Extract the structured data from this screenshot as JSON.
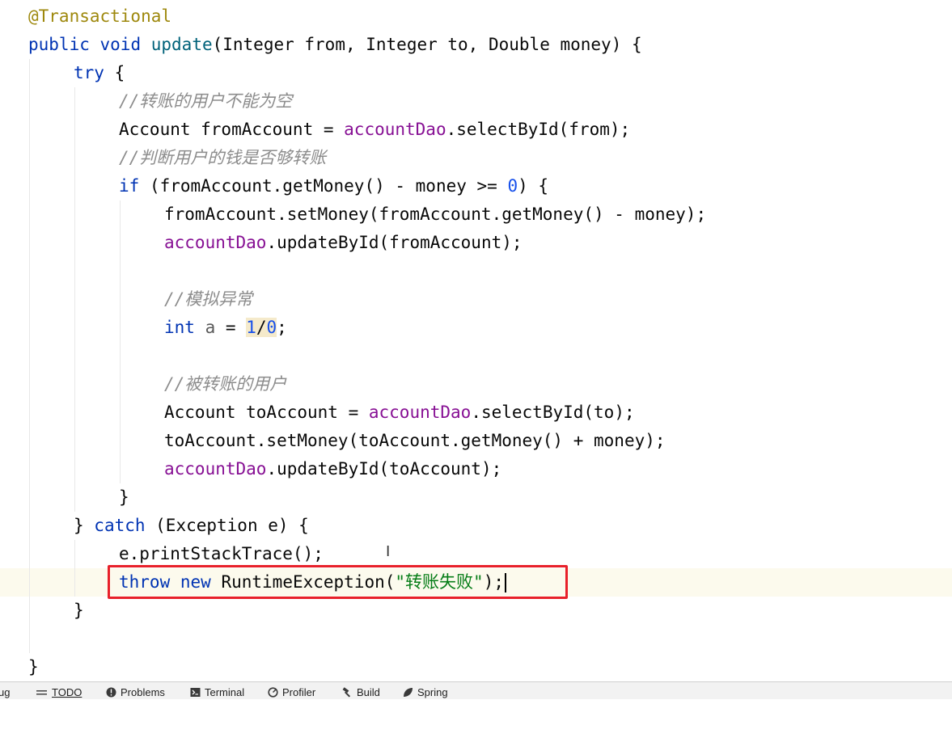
{
  "code_lines": [
    "@Transactional",
    "public void update(Integer from, Integer to, Double money) {",
    "try {",
    "//转账的用户不能为空",
    "Account fromAccount = accountDao.selectById(from);",
    "//判断用户的钱是否够转账",
    "if (fromAccount.getMoney() - money >= 0) {",
    "fromAccount.setMoney(fromAccount.getMoney() - money);",
    "accountDao.updateById(fromAccount);",
    "",
    "//模拟异常",
    "int a = 1/0;",
    "",
    "//被转账的用户",
    "Account toAccount = accountDao.selectById(to);",
    "toAccount.setMoney(toAccount.getMoney() + money);",
    "accountDao.updateById(toAccount);",
    "}",
    "} catch (Exception e) {",
    "e.printStackTrace();",
    "throw new RuntimeException(\"转账失败\");",
    "}",
    "",
    "}"
  ],
  "tokens": {
    "l0": {
      "ann": "@Transactional"
    },
    "l1": {
      "kw1": "public",
      "kw2": "void",
      "fn": "update",
      "rest": "(Integer from, Integer to, Double money) {"
    },
    "l2": {
      "kw": "try",
      "rest": " {"
    },
    "l3": {
      "cmt": "//转账的用户不能为空"
    },
    "l4": {
      "a": "Account fromAccount = ",
      "fld": "accountDao",
      "b": ".selectById(from);"
    },
    "l5": {
      "cmt": "//判断用户的钱是否够转账"
    },
    "l6": {
      "kw": "if",
      "a": " (fromAccount.getMoney() - money >= ",
      "num": "0",
      "b": ") {"
    },
    "l7": {
      "a": "fromAccount.setMoney(fromAccount.getMoney() - money);"
    },
    "l8": {
      "fld": "accountDao",
      "b": ".updateById(fromAccount);"
    },
    "l10": {
      "cmt": "//模拟异常"
    },
    "l11": {
      "kw": "int",
      "var": "a",
      "eq": " = ",
      "n1": "1",
      "slash": "/",
      "n2": "0",
      "semi": ";"
    },
    "l13": {
      "cmt": "//被转账的用户"
    },
    "l14": {
      "a": "Account toAccount = ",
      "fld": "accountDao",
      "b": ".selectById(to);"
    },
    "l15": {
      "a": "toAccount.setMoney(toAccount.getMoney() + money);"
    },
    "l16": {
      "fld": "accountDao",
      "b": ".updateById(toAccount);"
    },
    "l17": {
      "a": "}"
    },
    "l18": {
      "a": "} ",
      "kw": "catch",
      "b": " (Exception e) {"
    },
    "l19": {
      "a": "e.printStackTrace();"
    },
    "l20": {
      "kw1": "throw",
      "kw2": "new",
      "a": "RuntimeException(",
      "str": "\"转账失败\"",
      "b": ");"
    },
    "l21": {
      "a": "}"
    },
    "l23": {
      "a": "}"
    }
  },
  "toolbar": {
    "items": [
      {
        "label": "ug",
        "icon": "bug-icon"
      },
      {
        "label": "TODO",
        "icon": "list-icon"
      },
      {
        "label": "Problems",
        "icon": "error-icon"
      },
      {
        "label": "Terminal",
        "icon": "terminal-icon"
      },
      {
        "label": "Profiler",
        "icon": "profiler-icon"
      },
      {
        "label": "Build",
        "icon": "hammer-icon"
      },
      {
        "label": "Spring",
        "icon": "spring-leaf-icon"
      }
    ]
  },
  "colors": {
    "keyword": "#0033b3",
    "annotation": "#9e880d",
    "method": "#00627a",
    "field": "#871094",
    "comment": "#8c8c8c",
    "number": "#1750eb",
    "string": "#067d17",
    "highlight_box": "#e8202a",
    "caret_line": "#fcfaed"
  }
}
